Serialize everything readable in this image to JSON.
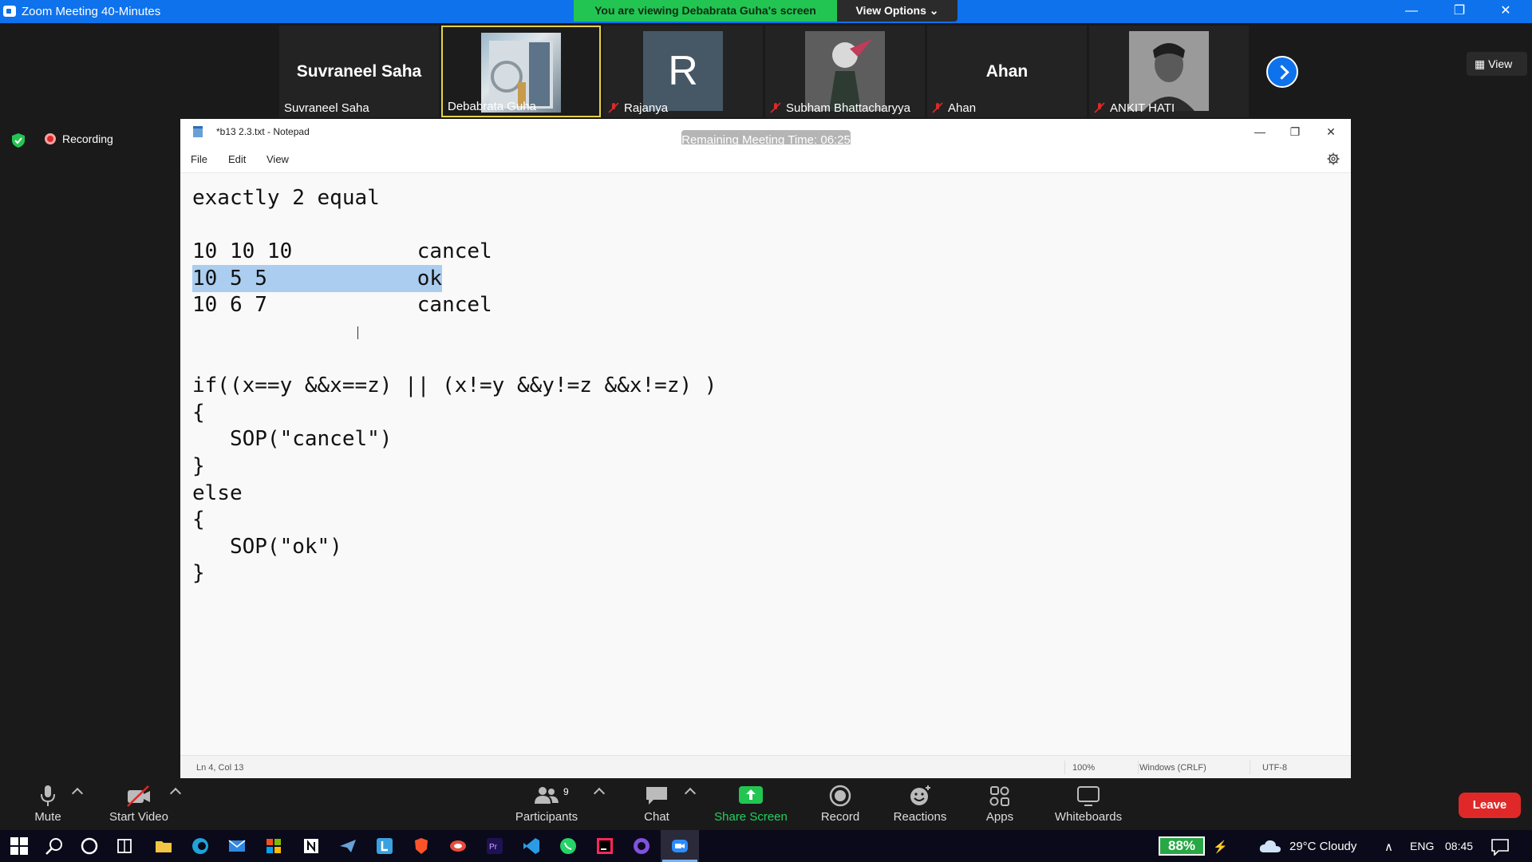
{
  "window": {
    "title": "Zoom Meeting 40-Minutes",
    "viewing_banner": "You are viewing Debabrata Guha's screen",
    "view_options": "View Options ⌄"
  },
  "participants_strip": [
    {
      "name": "Suvraneel Saha",
      "big_name": "Suvraneel Saha",
      "muted": false,
      "avatar": "none"
    },
    {
      "name": "Debabrata Guha",
      "muted": false,
      "avatar": "photo",
      "active": true
    },
    {
      "name": "Rajanya",
      "muted": true,
      "avatar": "letter",
      "letter": "R"
    },
    {
      "name": "Subham Bhattacharyya",
      "muted": true,
      "avatar": "photo"
    },
    {
      "name": "Ahan",
      "big_name": "Ahan",
      "muted": true,
      "avatar": "none"
    },
    {
      "name": "ANKIT HATI",
      "muted": true,
      "avatar": "photo"
    }
  ],
  "view_button": "View",
  "recording_label": "Recording",
  "notepad": {
    "title": "*b13 2.3.txt - Notepad",
    "remaining_time": "Remaining Meeting Time: 06:25",
    "menu": [
      "File",
      "Edit",
      "View"
    ],
    "lines": [
      {
        "text": "exactly 2 equal",
        "selected": false
      },
      {
        "text": "",
        "selected": false
      },
      {
        "text": "10 10 10          cancel",
        "selected": false
      },
      {
        "text": "10 5 5            ok",
        "selected": true
      },
      {
        "text": "10 6 7            cancel",
        "selected": false
      },
      {
        "text": "",
        "selected": false
      },
      {
        "text": "",
        "selected": false
      },
      {
        "text": "if((x==y &&x==z) || (x!=y &&y!=z &&x!=z) )",
        "selected": false
      },
      {
        "text": "{",
        "selected": false
      },
      {
        "text": "   SOP(\"cancel\")",
        "selected": false
      },
      {
        "text": "}",
        "selected": false
      },
      {
        "text": "else",
        "selected": false
      },
      {
        "text": "{",
        "selected": false
      },
      {
        "text": "   SOP(\"ok\")",
        "selected": false
      },
      {
        "text": "}",
        "selected": false
      }
    ],
    "status": {
      "position": "Ln 4, Col 13",
      "zoom": "100%",
      "line_ending": "Windows (CRLF)",
      "encoding": "UTF-8"
    }
  },
  "toolbar": {
    "mute": "Mute",
    "start_video": "Start Video",
    "participants": "Participants",
    "participants_count": "9",
    "chat": "Chat",
    "share_screen": "Share Screen",
    "record": "Record",
    "reactions": "Reactions",
    "apps": "Apps",
    "whiteboards": "Whiteboards",
    "leave": "Leave"
  },
  "taskbar": {
    "battery": "88%",
    "weather": "29°C  Cloudy",
    "language": "ENG",
    "time": "08:45"
  },
  "colors": {
    "zoom_blue": "#0e72ed",
    "banner_green": "#23c552",
    "leave_red": "#e02828",
    "selection": "#abcdef"
  }
}
